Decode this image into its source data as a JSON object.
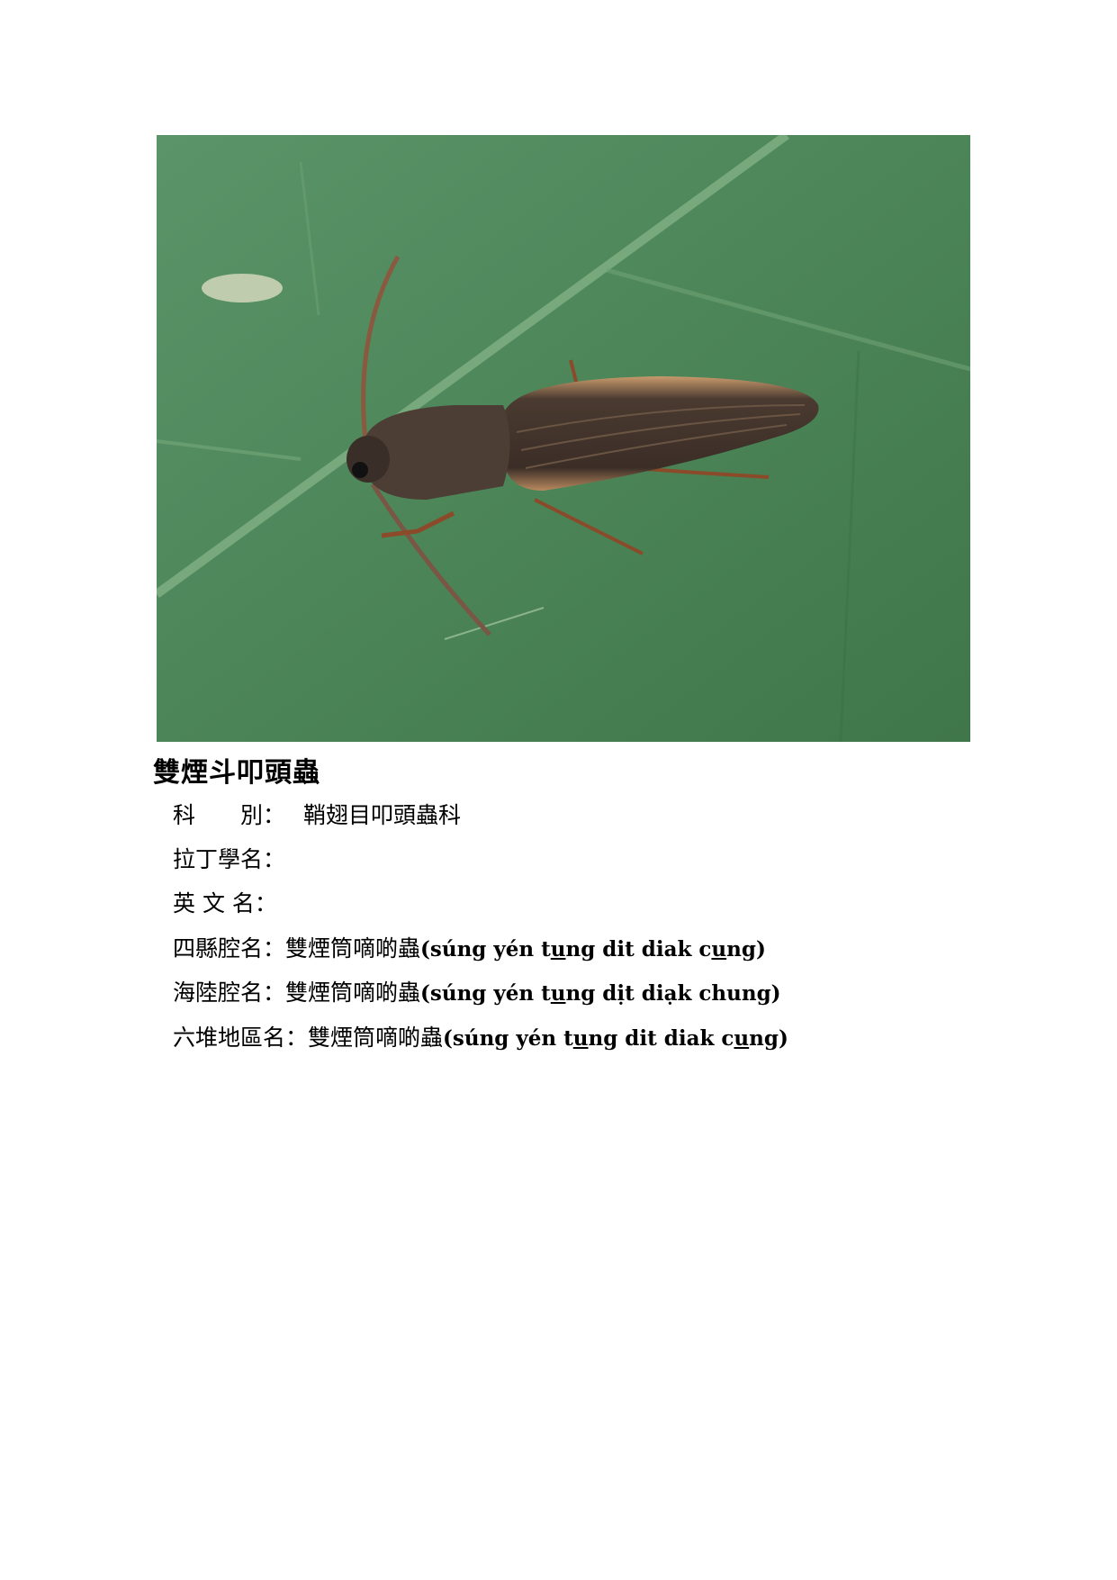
{
  "colors": {
    "leaf": "#4f8a5c",
    "leaf_dark": "#3f7449",
    "vein": "#7fae80",
    "beetle_dark": "#3a2f28",
    "beetle_edge": "#b8895f"
  },
  "title": "雙煙斗叩頭蟲",
  "fields": {
    "family": {
      "label": "科　　別：",
      "value": "鞘翅目叩頭蟲科"
    },
    "latin": {
      "label": "拉丁學名：",
      "value": ""
    },
    "english": {
      "label": "英 文 名：",
      "value": ""
    },
    "sixian": {
      "label": "四縣腔名：",
      "hanzi": "雙煙筒嘀啲蟲",
      "rom_a": "(súng yén t",
      "rom_u1": "u",
      "rom_b": "ng dit diak c",
      "rom_u2": "u",
      "rom_c": "ng)"
    },
    "hailu": {
      "label": "海陸腔名：",
      "hanzi": "雙煙筒嘀啲蟲",
      "rom_a": "(súng yén t",
      "rom_u1": "u",
      "rom_b": "ng dịt diạk chung)"
    },
    "liudui": {
      "label": "六堆地區名：",
      "hanzi": "雙煙筒嘀啲蟲",
      "rom_a": "(súng yén t",
      "rom_u1": "u",
      "rom_b": "ng dit diak c",
      "rom_u2": "u",
      "rom_c": "ng)"
    }
  }
}
